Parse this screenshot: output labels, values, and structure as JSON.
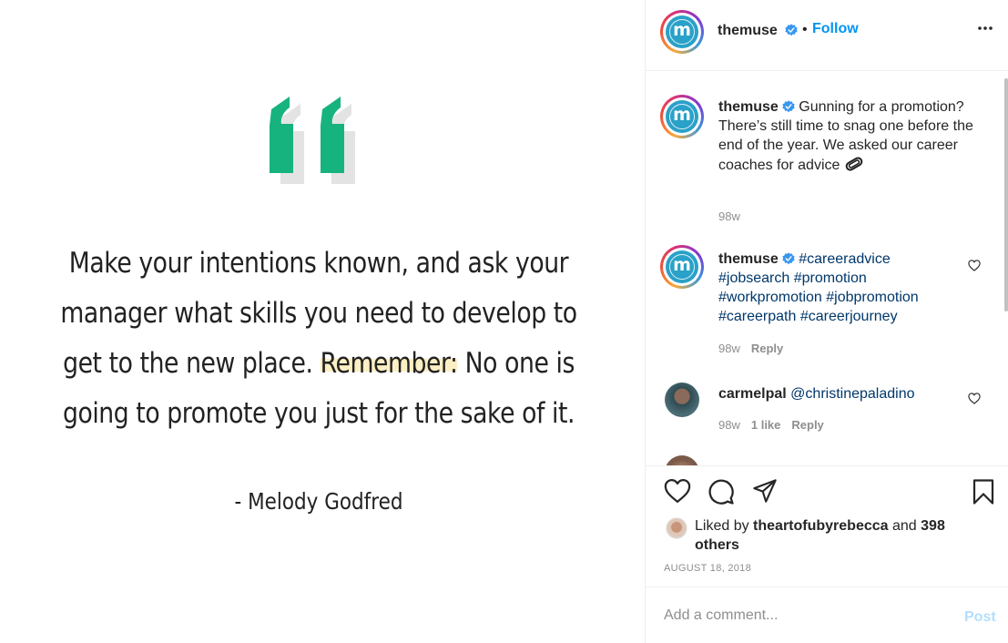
{
  "post": {
    "image": {
      "quote_line1": "Make your intentions known, and ask your",
      "quote_line2": "manager what skills you need to develop to",
      "quote_line3_pre": "get to the new place. ",
      "quote_line3_hl": "Remember:",
      "quote_line3_post": " No one is",
      "quote_line4": "going to promote you just for the sake of it.",
      "author": "- Melody Godfred",
      "accent_color": "#17b37e"
    },
    "header": {
      "avatar_letter": "m",
      "username": "themuse",
      "dot": "•",
      "follow_label": "Follow"
    },
    "comments": [
      {
        "username": "themuse",
        "text": "Gunning for a promotion? There’s still time to snag one before the end of the year. We asked our career coaches for advice",
        "emoji": "paperclip-emoji",
        "time": "98w"
      },
      {
        "username": "themuse",
        "tags": [
          "#careeradvice",
          "#jobsearch",
          "#promotion",
          "#workpromotion",
          "#jobpromotion",
          "#careerpath",
          "#careerjourney"
        ],
        "time": "98w",
        "reply_label": "Reply"
      },
      {
        "username": "carmelpal",
        "mention": "@christinepaladino",
        "time": "98w",
        "likes": "1 like",
        "reply_label": "Reply"
      }
    ],
    "liked_by": {
      "prefix": "Liked by",
      "user": "theartofubyrebecca",
      "and": "and",
      "others": "398 others"
    },
    "date": "AUGUST 18, 2018",
    "comment_box": {
      "placeholder": "Add a comment...",
      "post_label": "Post"
    }
  },
  "colors": {
    "link": "#0095f6",
    "tag": "#00376b",
    "muted": "#8e8e8e",
    "verified": "#3897f0"
  },
  "icons": [
    "more-options-icon",
    "verified-icon",
    "heart-icon",
    "comment-icon",
    "share-icon",
    "bookmark-icon"
  ]
}
